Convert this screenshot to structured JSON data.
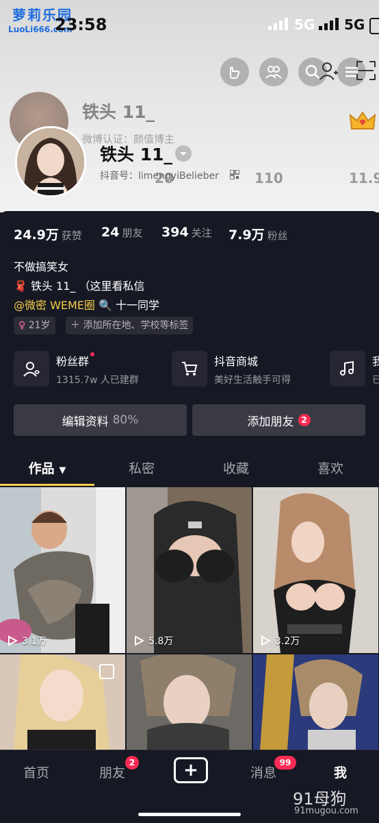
{
  "watermark_top": {
    "brand": "萝莉乐园",
    "url": "LuoLi666.com"
  },
  "status_bar": {
    "time": "23:58",
    "network_1": "5G",
    "network_2": "5G"
  },
  "ghost_profile": {
    "name": "铁头 11_",
    "verification": "微博认证：颜值博主",
    "stat_1": "20",
    "stat_2": "110",
    "stat_3": "11.9"
  },
  "profile": {
    "name": "铁头 11_",
    "douyin_id": "抖音号：limengyiBelieber"
  },
  "stats": [
    {
      "value": "24.9万",
      "label": "获赞"
    },
    {
      "value": "24",
      "label": "朋友"
    },
    {
      "value": "394",
      "label": "关注"
    },
    {
      "value": "7.9万",
      "label": "粉丝"
    }
  ],
  "bio": {
    "line1": "不做搞笑女",
    "line2_emoji": "🧣",
    "line2": "铁头 11_ （这里看私信",
    "line3_mention": "@微密 WEME圈",
    "line3_emoji": "🔍",
    "line3_rest": "十一同学"
  },
  "tags": {
    "age": "21岁",
    "add": "添加所在地、学校等标签"
  },
  "features": [
    {
      "title": "粉丝群",
      "subtitle": "1315.7w 人已建群",
      "icon": "fan-group-icon"
    },
    {
      "title": "抖音商城",
      "subtitle": "美好生活触手可得",
      "icon": "cart-icon"
    },
    {
      "title": "我",
      "subtitle": "已",
      "icon": "music-icon"
    }
  ],
  "buttons": {
    "edit": "编辑资料",
    "edit_pct": "80%",
    "add_friend": "添加朋友",
    "add_friend_badge": "2"
  },
  "tabs": [
    "作品",
    "私密",
    "收藏",
    "喜欢"
  ],
  "videos": [
    {
      "plays": "3.1万"
    },
    {
      "plays": "5.8万"
    },
    {
      "plays": "3.2万"
    },
    {
      "plays": ""
    },
    {
      "plays": ""
    },
    {
      "plays": ""
    }
  ],
  "nav": {
    "home": "首页",
    "friends": "朋友",
    "friends_badge": "2",
    "plus": "+",
    "messages": "消息",
    "messages_badge": "99",
    "me": "我"
  },
  "watermark_bottom": {
    "brand": "91母狗",
    "url": "91mugou.com"
  },
  "colors": {
    "background": "#161823",
    "accent_red": "#fe2c55",
    "accent_gold": "#f7cf4b",
    "button_bg": "#393a44"
  }
}
